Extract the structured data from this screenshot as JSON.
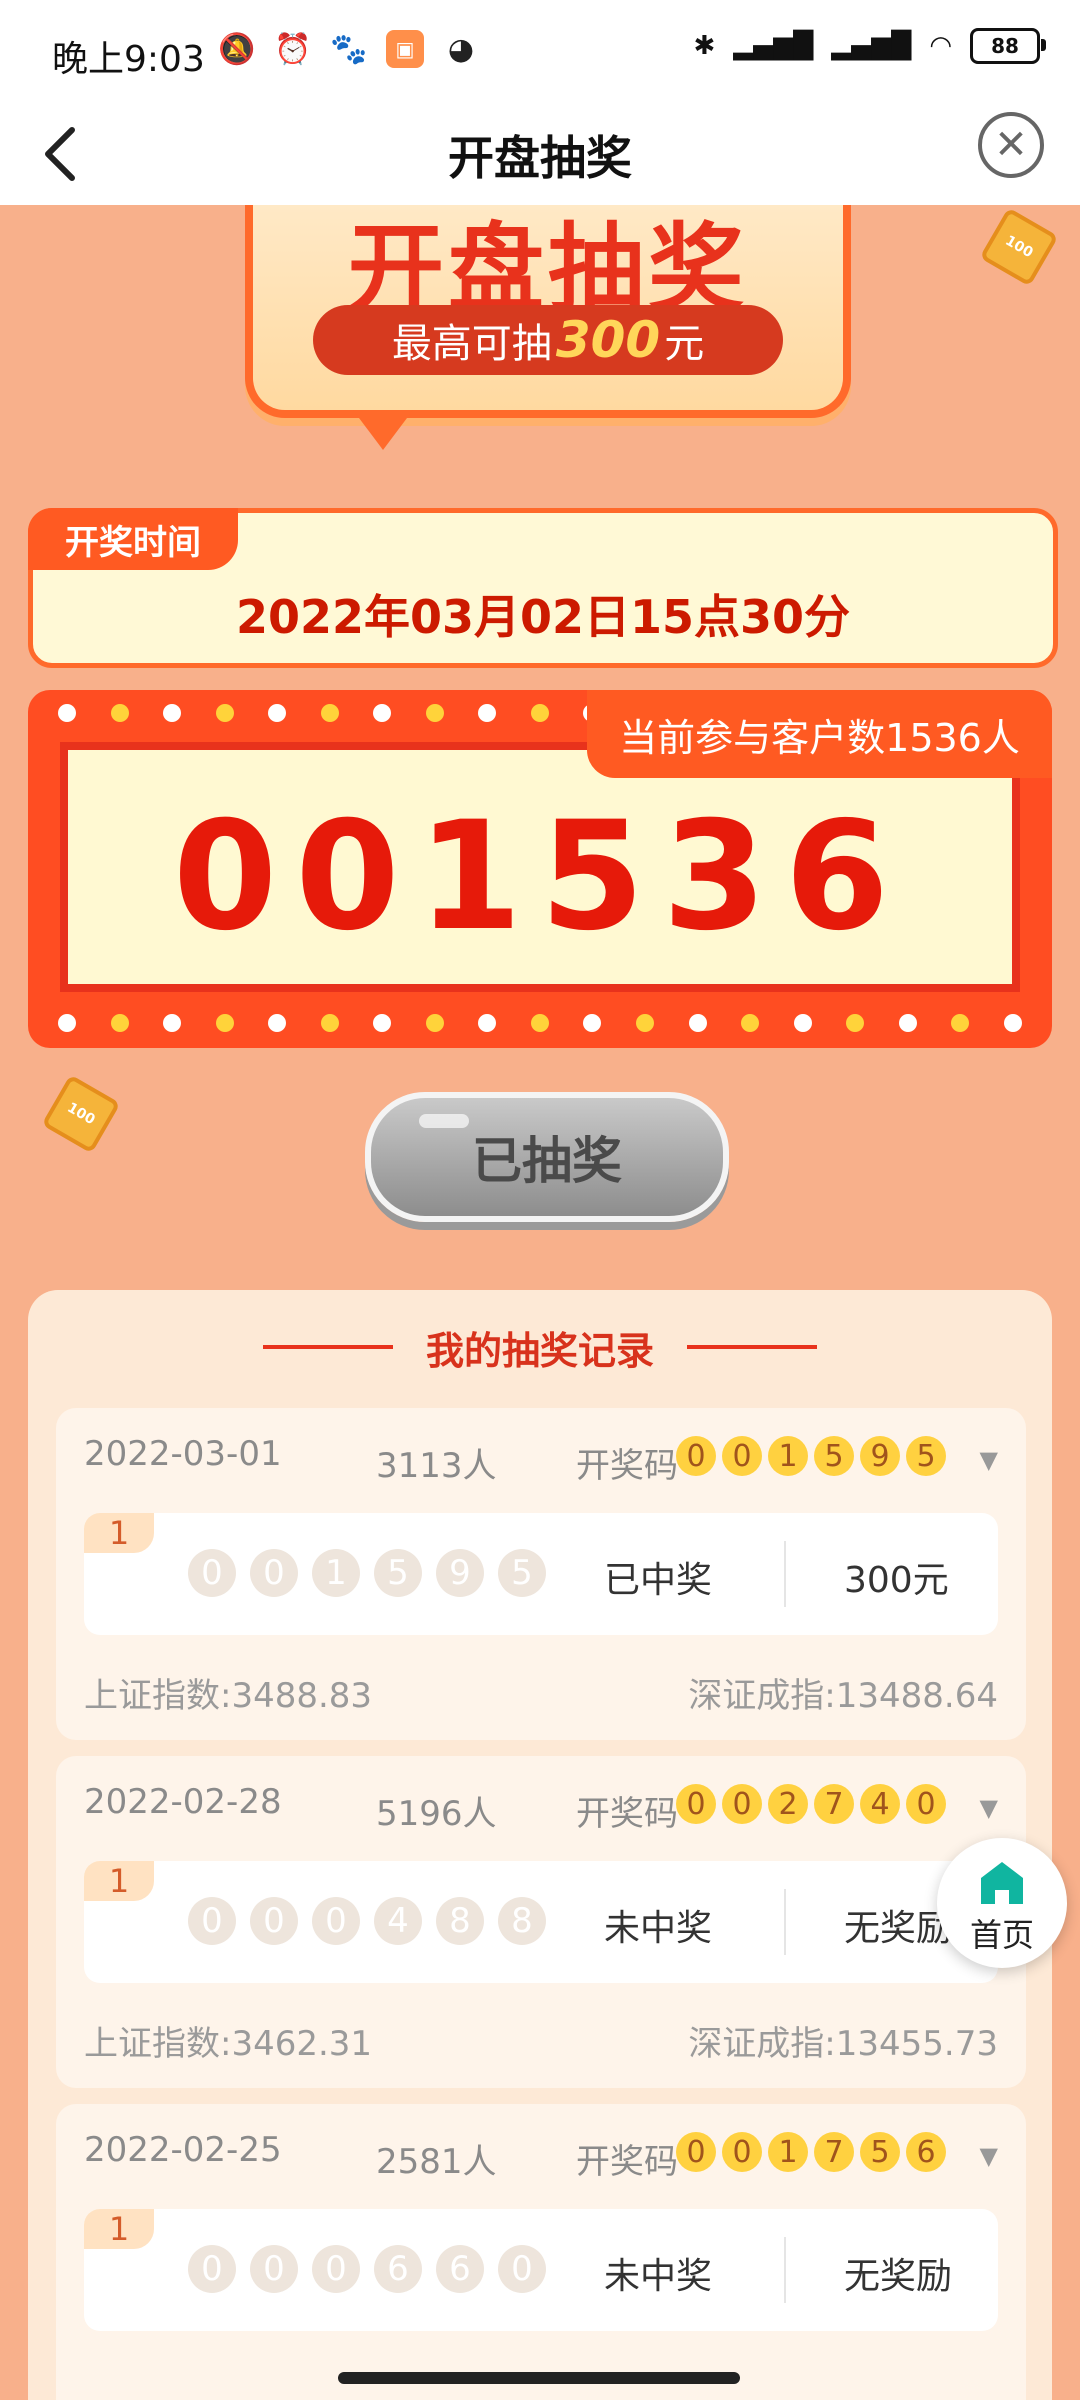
{
  "status_bar": {
    "time": "晚上9:03",
    "battery": "88"
  },
  "nav": {
    "title": "开盘抽奖"
  },
  "hero": {
    "title": "开盘抽奖",
    "subtitle_prefix": "最高可抽",
    "subtitle_amount": "300",
    "subtitle_suffix": "元"
  },
  "draw_time": {
    "label": "开奖时间",
    "value": "2022年03月02日15点30分"
  },
  "counter": {
    "badge": "当前参与客户数1536人",
    "number": "001536"
  },
  "draw_button": {
    "label": "已抽奖"
  },
  "records": {
    "title": "我的抽奖记录",
    "code_label": "开奖码",
    "items": [
      {
        "date": "2022-03-01",
        "people": "3113人",
        "code": [
          "0",
          "0",
          "1",
          "5",
          "9",
          "5"
        ],
        "tag": "1",
        "mine": [
          "0",
          "0",
          "1",
          "5",
          "9",
          "5"
        ],
        "result": "已中奖",
        "prize": "300元",
        "sh": "上证指数:3488.83",
        "sz": "深证成指:13488.64"
      },
      {
        "date": "2022-02-28",
        "people": "5196人",
        "code": [
          "0",
          "0",
          "2",
          "7",
          "4",
          "0"
        ],
        "tag": "1",
        "mine": [
          "0",
          "0",
          "0",
          "4",
          "8",
          "8"
        ],
        "result": "未中奖",
        "prize": "无奖励",
        "sh": "上证指数:3462.31",
        "sz": "深证成指:13455.73"
      },
      {
        "date": "2022-02-25",
        "people": "2581人",
        "code": [
          "0",
          "0",
          "1",
          "7",
          "5",
          "6"
        ],
        "tag": "1",
        "mine": [
          "0",
          "0",
          "0",
          "6",
          "6",
          "0"
        ],
        "result": "未中奖",
        "prize": "无奖励",
        "sh": "",
        "sz": ""
      }
    ]
  },
  "home_fab": {
    "label": "首页"
  },
  "colors": {
    "background": "#f8b08b",
    "accent": "#ff4d22",
    "number": "#e61a0a"
  }
}
